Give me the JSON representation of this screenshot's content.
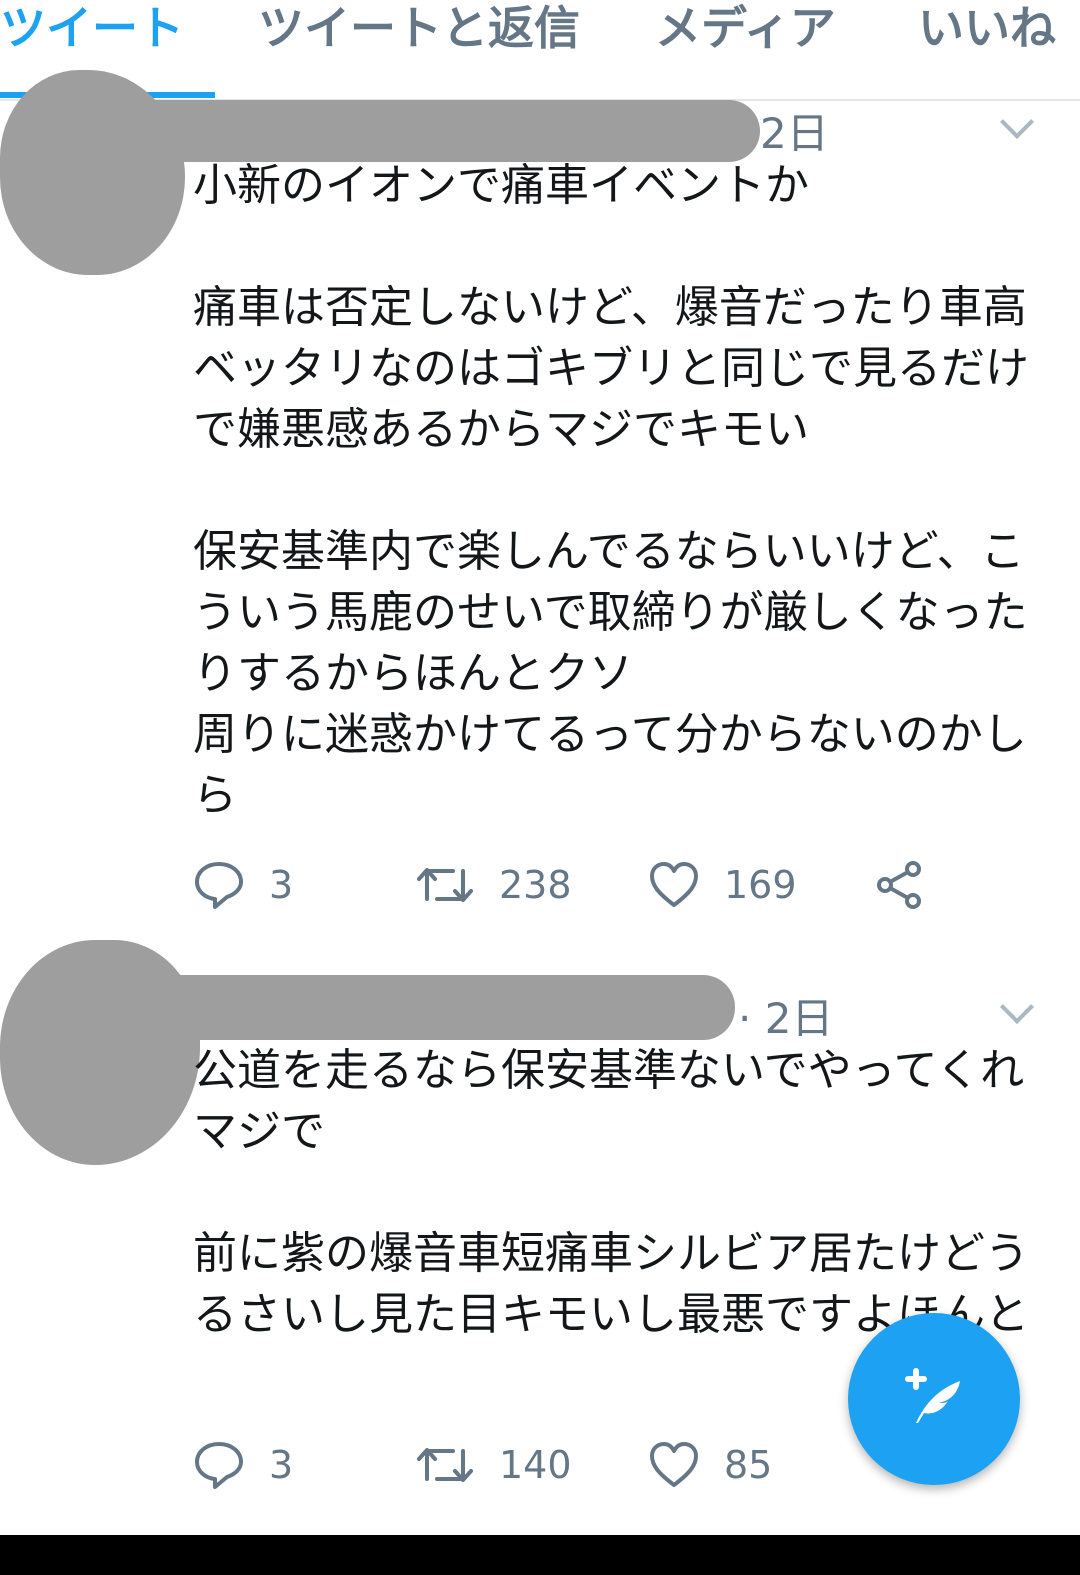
{
  "tabs": [
    {
      "label": "ツイート",
      "active": true
    },
    {
      "label": "ツイートと返信",
      "active": false
    },
    {
      "label": "メディア",
      "active": false
    },
    {
      "label": "いいね",
      "active": false
    }
  ],
  "tweets": [
    {
      "time": "2日",
      "text": "小新のイオンで痛車イベントか\n\n痛車は否定しないけど、爆音だったり車高ベッタリなのはゴキブリと同じで見るだけで嫌悪感あるからマジでキモい\n\n保安基準内で楽しんでるならいいけど、こういう馬鹿のせいで取締りが厳しくなったりするからほんとクソ\n周りに迷惑かけてるって分からないのかしら",
      "replies": "3",
      "retweets": "238",
      "likes": "169"
    },
    {
      "time": "· 2日",
      "text": "公道を走るなら保安基準ないでやってくれマジで\n\n前に紫の爆音車短痛車シルビア居たけどうるさいし見た目キモいし最悪ですよほんと",
      "replies": "3",
      "retweets": "140",
      "likes": "85"
    }
  ],
  "colors": {
    "accent": "#1da1f2",
    "muted": "#657786",
    "redaction": "#9e9e9e"
  },
  "icons": {
    "reply": "speech-bubble",
    "retweet": "retweet-arrows",
    "like": "heart",
    "share": "share-nodes",
    "compose": "feather-plus"
  }
}
